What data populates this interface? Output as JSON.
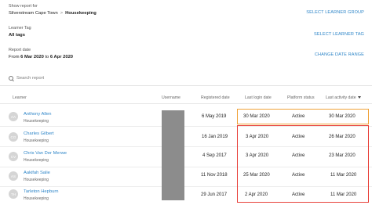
{
  "filters": {
    "show_report_for": {
      "label": "Show report for",
      "location": "Silverstream Cape Town",
      "separator": ">",
      "group": "Housekeeping",
      "action": "SELECT LEARNER GROUP"
    },
    "learner_tag": {
      "label": "Learner Tag",
      "value": "All tags",
      "action": "SELECT LEARNER TAG"
    },
    "report_date": {
      "label": "Report date",
      "from_label": "From",
      "from_value": "6 Mar 2020",
      "to_label": "to",
      "to_value": "6 Apr 2020",
      "action": "CHANGE DATE RANGE"
    }
  },
  "search": {
    "placeholder": "Search report",
    "icon": "search-icon"
  },
  "table": {
    "headers": {
      "learner": "Learner",
      "username": "Username",
      "registered": "Registered date",
      "last_login": "Last login date",
      "platform_status": "Platform status",
      "last_activity": "Last activity date"
    },
    "rows": [
      {
        "initials": "AA",
        "name": "Anthony Allen",
        "tag": "Housekeeping",
        "registered": "6 May 2019",
        "last_login": "30 Mar 2020",
        "status": "Active",
        "last_activity": "30 Mar 2020"
      },
      {
        "initials": "CG",
        "name": "Charles Gilbert",
        "tag": "Housekeeping",
        "registered": "16 Jan 2019",
        "last_login": "3 Apr 2020",
        "status": "Active",
        "last_activity": "26 Mar 2020"
      },
      {
        "initials": "CV",
        "name": "Chris Van Der Merwe",
        "tag": "Housekeeping",
        "registered": "4 Sep 2017",
        "last_login": "3 Apr 2020",
        "status": "Active",
        "last_activity": "23 Mar 2020"
      },
      {
        "initials": "AS",
        "name": "Aakifah Salie",
        "tag": "Housekeeping",
        "registered": "11 Nov 2018",
        "last_login": "25 Mar 2020",
        "status": "Active",
        "last_activity": "11 Mar 2020"
      },
      {
        "initials": "TH",
        "name": "Tarleton Hepburn",
        "tag": "Housekeeping",
        "registered": "29 Jun 2017",
        "last_login": "2 Apr 2020",
        "status": "Active",
        "last_activity": "11 Mar 2020"
      }
    ]
  },
  "colors": {
    "accent": "#2f86c8",
    "highlight_orange": "#f0a239",
    "highlight_red": "#e8413a"
  }
}
